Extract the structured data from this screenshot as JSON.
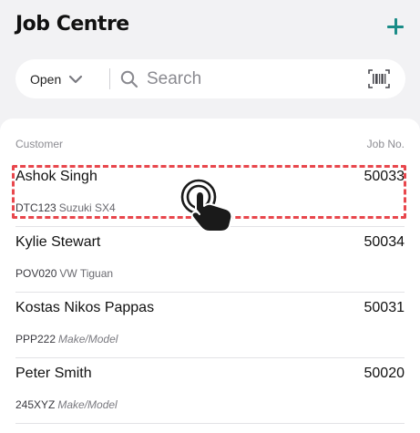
{
  "header": {
    "title": "Job Centre",
    "add_icon": "plus-icon",
    "accent_color": "#1a8c87"
  },
  "search": {
    "filter_value": "Open",
    "placeholder": "Search",
    "search_icon": "search-icon",
    "barcode_icon": "barcode-scan-icon"
  },
  "list": {
    "headers": {
      "customer": "Customer",
      "job_no": "Job No."
    },
    "rows": [
      {
        "customer": "Ashok Singh",
        "job_no": "50033",
        "rego": "DTC123",
        "model": "Suzuki SX4"
      },
      {
        "customer": "Kylie Stewart",
        "job_no": "50034",
        "rego": "POV020",
        "model": "VW Tiguan"
      },
      {
        "customer": "Kostas Nikos Pappas",
        "job_no": "50031",
        "rego": "PPP222",
        "model": "Make/Model"
      },
      {
        "customer": "Peter Smith",
        "job_no": "50020",
        "rego": "245XYZ",
        "model": "Make/Model"
      }
    ]
  },
  "overlay": {
    "highlight_color": "#e8474d",
    "tap_icon": "tap-gesture-icon"
  }
}
